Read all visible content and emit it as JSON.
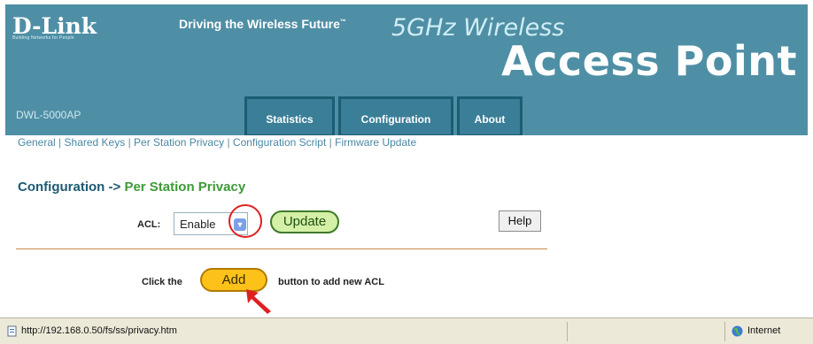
{
  "brand": {
    "logo": "D-Link",
    "logo_tagline": "Building Networks for People",
    "slogan": "Driving the Wireless Future",
    "slogan_mark": "™",
    "band": "5GHz Wireless",
    "product": "Access Point",
    "model": "DWL-5000AP",
    "color_header": "#4f8fa5",
    "color_tab": "#3a7f97"
  },
  "tabs": [
    "Statistics",
    "Configuration",
    "About"
  ],
  "subnav": [
    "General",
    "Shared Keys",
    "Per Station Privacy",
    "Configuration Script",
    "Firmware Update"
  ],
  "subnav_separator": "|",
  "breadcrumb": {
    "section": "Configuration",
    "arrow": "->",
    "current": "Per Station Privacy"
  },
  "acl": {
    "label": "ACL:",
    "selected": "Enable",
    "arrow_icon": "chevron-down-icon"
  },
  "buttons": {
    "update": "Update",
    "help": "Help",
    "add": "Add"
  },
  "add_sentence": {
    "before": "Click the",
    "after": "button to add new ACL"
  },
  "statusbar": {
    "url": "http://192.168.0.50/fs/ss/privacy.htm",
    "zone": "Internet"
  }
}
